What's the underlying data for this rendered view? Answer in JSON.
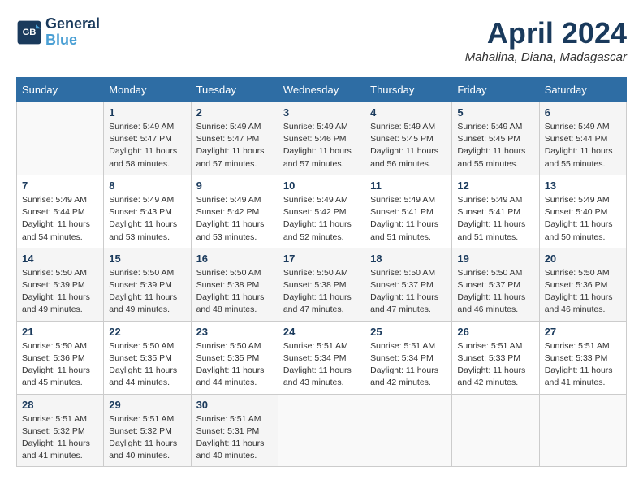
{
  "header": {
    "logo_line1": "General",
    "logo_line2": "Blue",
    "month_title": "April 2024",
    "location": "Mahalina, Diana, Madagascar"
  },
  "days_of_week": [
    "Sunday",
    "Monday",
    "Tuesday",
    "Wednesday",
    "Thursday",
    "Friday",
    "Saturday"
  ],
  "weeks": [
    [
      {
        "day": "",
        "info": ""
      },
      {
        "day": "1",
        "info": "Sunrise: 5:49 AM\nSunset: 5:47 PM\nDaylight: 11 hours\nand 58 minutes."
      },
      {
        "day": "2",
        "info": "Sunrise: 5:49 AM\nSunset: 5:47 PM\nDaylight: 11 hours\nand 57 minutes."
      },
      {
        "day": "3",
        "info": "Sunrise: 5:49 AM\nSunset: 5:46 PM\nDaylight: 11 hours\nand 57 minutes."
      },
      {
        "day": "4",
        "info": "Sunrise: 5:49 AM\nSunset: 5:45 PM\nDaylight: 11 hours\nand 56 minutes."
      },
      {
        "day": "5",
        "info": "Sunrise: 5:49 AM\nSunset: 5:45 PM\nDaylight: 11 hours\nand 55 minutes."
      },
      {
        "day": "6",
        "info": "Sunrise: 5:49 AM\nSunset: 5:44 PM\nDaylight: 11 hours\nand 55 minutes."
      }
    ],
    [
      {
        "day": "7",
        "info": "Sunrise: 5:49 AM\nSunset: 5:44 PM\nDaylight: 11 hours\nand 54 minutes."
      },
      {
        "day": "8",
        "info": "Sunrise: 5:49 AM\nSunset: 5:43 PM\nDaylight: 11 hours\nand 53 minutes."
      },
      {
        "day": "9",
        "info": "Sunrise: 5:49 AM\nSunset: 5:42 PM\nDaylight: 11 hours\nand 53 minutes."
      },
      {
        "day": "10",
        "info": "Sunrise: 5:49 AM\nSunset: 5:42 PM\nDaylight: 11 hours\nand 52 minutes."
      },
      {
        "day": "11",
        "info": "Sunrise: 5:49 AM\nSunset: 5:41 PM\nDaylight: 11 hours\nand 51 minutes."
      },
      {
        "day": "12",
        "info": "Sunrise: 5:49 AM\nSunset: 5:41 PM\nDaylight: 11 hours\nand 51 minutes."
      },
      {
        "day": "13",
        "info": "Sunrise: 5:49 AM\nSunset: 5:40 PM\nDaylight: 11 hours\nand 50 minutes."
      }
    ],
    [
      {
        "day": "14",
        "info": "Sunrise: 5:50 AM\nSunset: 5:39 PM\nDaylight: 11 hours\nand 49 minutes."
      },
      {
        "day": "15",
        "info": "Sunrise: 5:50 AM\nSunset: 5:39 PM\nDaylight: 11 hours\nand 49 minutes."
      },
      {
        "day": "16",
        "info": "Sunrise: 5:50 AM\nSunset: 5:38 PM\nDaylight: 11 hours\nand 48 minutes."
      },
      {
        "day": "17",
        "info": "Sunrise: 5:50 AM\nSunset: 5:38 PM\nDaylight: 11 hours\nand 47 minutes."
      },
      {
        "day": "18",
        "info": "Sunrise: 5:50 AM\nSunset: 5:37 PM\nDaylight: 11 hours\nand 47 minutes."
      },
      {
        "day": "19",
        "info": "Sunrise: 5:50 AM\nSunset: 5:37 PM\nDaylight: 11 hours\nand 46 minutes."
      },
      {
        "day": "20",
        "info": "Sunrise: 5:50 AM\nSunset: 5:36 PM\nDaylight: 11 hours\nand 46 minutes."
      }
    ],
    [
      {
        "day": "21",
        "info": "Sunrise: 5:50 AM\nSunset: 5:36 PM\nDaylight: 11 hours\nand 45 minutes."
      },
      {
        "day": "22",
        "info": "Sunrise: 5:50 AM\nSunset: 5:35 PM\nDaylight: 11 hours\nand 44 minutes."
      },
      {
        "day": "23",
        "info": "Sunrise: 5:50 AM\nSunset: 5:35 PM\nDaylight: 11 hours\nand 44 minutes."
      },
      {
        "day": "24",
        "info": "Sunrise: 5:51 AM\nSunset: 5:34 PM\nDaylight: 11 hours\nand 43 minutes."
      },
      {
        "day": "25",
        "info": "Sunrise: 5:51 AM\nSunset: 5:34 PM\nDaylight: 11 hours\nand 42 minutes."
      },
      {
        "day": "26",
        "info": "Sunrise: 5:51 AM\nSunset: 5:33 PM\nDaylight: 11 hours\nand 42 minutes."
      },
      {
        "day": "27",
        "info": "Sunrise: 5:51 AM\nSunset: 5:33 PM\nDaylight: 11 hours\nand 41 minutes."
      }
    ],
    [
      {
        "day": "28",
        "info": "Sunrise: 5:51 AM\nSunset: 5:32 PM\nDaylight: 11 hours\nand 41 minutes."
      },
      {
        "day": "29",
        "info": "Sunrise: 5:51 AM\nSunset: 5:32 PM\nDaylight: 11 hours\nand 40 minutes."
      },
      {
        "day": "30",
        "info": "Sunrise: 5:51 AM\nSunset: 5:31 PM\nDaylight: 11 hours\nand 40 minutes."
      },
      {
        "day": "",
        "info": ""
      },
      {
        "day": "",
        "info": ""
      },
      {
        "day": "",
        "info": ""
      },
      {
        "day": "",
        "info": ""
      }
    ]
  ]
}
